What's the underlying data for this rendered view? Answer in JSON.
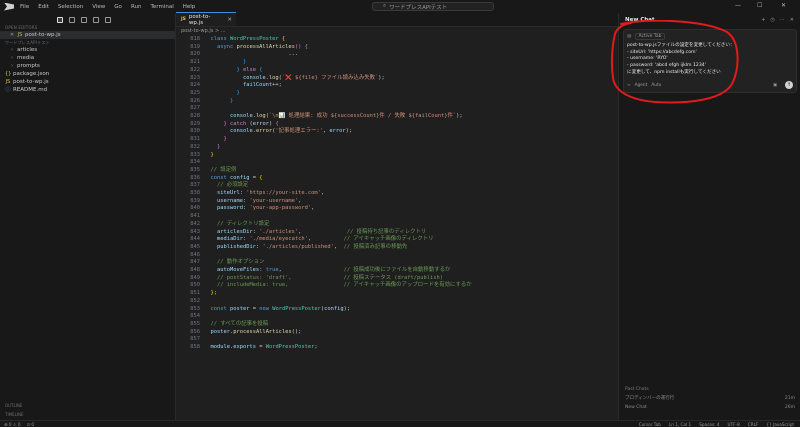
{
  "menu": [
    "File",
    "Edit",
    "Selection",
    "View",
    "Go",
    "Run",
    "Terminal",
    "Help"
  ],
  "search": {
    "placeholder": "ワードプレスAPIテスト"
  },
  "explorer": {
    "open_editors_label": "OPEN EDITORS",
    "open_file": "post-to-wp.js",
    "workspace_label": "ワードプレスAPIテスト",
    "items": [
      {
        "label": "articles",
        "kind": "folder"
      },
      {
        "label": "media",
        "kind": "folder"
      },
      {
        "label": "prompts",
        "kind": "folder"
      },
      {
        "label": "package.json",
        "kind": "json"
      },
      {
        "label": "post-to-wp.js",
        "kind": "js"
      },
      {
        "label": "README.md",
        "kind": "md"
      }
    ],
    "outline_label": "OUTLINE",
    "timeline_label": "TIMELINE"
  },
  "editor": {
    "tab_label": "post-to-wp.js",
    "breadcrumb": "post-to-wp.js > ...",
    "lines": [
      {
        "n": "",
        "html": "  <span class='kw'>class</span> <span class='cls'>WordPressPoster</span> <span class='br'>{</span>"
      },
      {
        "n": "",
        "html": "    <span class='kw'>async</span> <span class='fn'>processAllArticles</span><span class='br2'>()</span> <span class='br2'>{</span>"
      },
      {
        "n": "",
        "html": "                          <span class='pl'>...</span>"
      },
      {
        "n": "",
        "html": "            <span class='br3'>}</span>"
      },
      {
        "n": "",
        "html": "          <span class='br3'>}</span> <span class='kw2'>else</span> <span class='br3'>{</span>"
      },
      {
        "n": "",
        "html": "            <span class='var'>console</span>.<span class='fn'>log</span>(<span class='str'>`❌ ${file} ファイル読み込み失敗`</span>);"
      },
      {
        "n": "",
        "html": "            <span class='var'>failCount</span>++;"
      },
      {
        "n": "",
        "html": "          <span class='br3'>}</span>"
      },
      {
        "n": "",
        "html": "        <span class='br3'>}</span>"
      },
      {
        "n": "",
        "html": ""
      },
      {
        "n": "",
        "html": "        <span class='var'>console</span>.<span class='fn'>log</span>(<span class='str'>`\\n📊 処理結果: 成功 ${successCount}件 / 失敗 ${failCount}件`</span>);"
      },
      {
        "n": "",
        "html": "      <span class='br2'>}</span> <span class='kw2'>catch</span> (<span class='var'>error</span>) <span class='br2'>{</span>"
      },
      {
        "n": "",
        "html": "        <span class='var'>console</span>.<span class='fn'>error</span>(<span class='str'>'記事処理エラー:'</span>, <span class='var'>error</span>);"
      },
      {
        "n": "",
        "html": "      <span class='br2'>}</span>"
      },
      {
        "n": "",
        "html": "    <span class='br2'>}</span>"
      },
      {
        "n": "",
        "html": "  <span class='br'>}</span>"
      },
      {
        "n": "",
        "html": ""
      },
      {
        "n": "",
        "html": "  <span class='cm'>// 設定例</span>"
      },
      {
        "n": "",
        "html": "  <span class='kw'>const</span> <span class='var'>config</span> = <span class='br'>{</span>"
      },
      {
        "n": "",
        "html": "    <span class='cm'>// 必須設定</span>"
      },
      {
        "n": "",
        "html": "    <span class='var'>siteUrl</span>: <span class='str'>'https://your-site.com'</span>,"
      },
      {
        "n": "",
        "html": "    <span class='var'>username</span>: <span class='str'>'your-username'</span>,"
      },
      {
        "n": "",
        "html": "    <span class='var'>password</span>: <span class='str'>'your-app-password'</span>,"
      },
      {
        "n": "",
        "html": ""
      },
      {
        "n": "",
        "html": "    <span class='cm'>// ディレクトリ設定</span>"
      },
      {
        "n": "",
        "html": "    <span class='var'>articlesDir</span>: <span class='str'>'./articles'</span>,              <span class='cm'>// 投稿待ち記事のディレクトリ</span>"
      },
      {
        "n": "",
        "html": "    <span class='var'>mediaDir</span>: <span class='str'>'./media/eyecatch'</span>,          <span class='cm'>// アイキャッチ画像のディレクトリ</span>"
      },
      {
        "n": "",
        "html": "    <span class='var'>publishedDir</span>: <span class='str'>'./articles/published'</span>,  <span class='cm'>// 投稿済み記事の移動先</span>"
      },
      {
        "n": "",
        "html": ""
      },
      {
        "n": "",
        "html": "    <span class='cm'>// 動作オプション</span>"
      },
      {
        "n": "",
        "html": "    <span class='var'>autoMoveFiles</span>: <span class='kw'>true</span>,                   <span class='cm'>// 投稿成功後にファイルを自動移動するか</span>"
      },
      {
        "n": "",
        "html": "    <span class='cm'>// postStatus: 'draft',                // 投稿ステータス (draft/publish)</span>"
      },
      {
        "n": "",
        "html": "    <span class='cm'>// includeMedia: true,                 // アイキャッチ画像のアップロードを有効にするか</span>"
      },
      {
        "n": "",
        "html": "  <span class='br'>}</span>;"
      },
      {
        "n": "",
        "html": ""
      },
      {
        "n": "",
        "html": "  <span class='kw'>const</span> <span class='var'>poster</span> = <span class='kw'>new</span> <span class='cls'>WordPressPoster</span>(<span class='var'>config</span>);"
      },
      {
        "n": "",
        "html": ""
      },
      {
        "n": "",
        "html": "  <span class='cm'>// すべての記事を投稿</span>"
      },
      {
        "n": "",
        "html": "  <span class='var'>poster</span>.<span class='fn'>processAllArticles</span>();"
      },
      {
        "n": "",
        "html": ""
      },
      {
        "n": "",
        "html": "  <span class='var'>module</span>.<span class='var'>exports</span> = <span class='cls'>WordPressPoster</span>;"
      }
    ]
  },
  "chat": {
    "title": "New Chat",
    "context_label": "Active Tab",
    "message_lines": [
      "post-to-wp.jsファイルの設定を変更してください：",
      "- siteUrl: 'https://abcdefg.com'",
      "- username: 'RYO'",
      "- password: 'abcd efgh ijklm 1234'",
      "に変更して、npm installも実行してください"
    ],
    "mode_label": "Agent",
    "model_label": "Auto",
    "past_chats_label": "Past Chats",
    "past_chats": [
      {
        "title": "プロディンバーの運行行",
        "time": "21m"
      },
      {
        "title": "New Chat",
        "time": "26m"
      }
    ]
  },
  "status": {
    "left": [
      "⊗ 0 ⚠ 0",
      "⊙ 0"
    ],
    "right": [
      "Cursor Tab",
      "Ln 1, Col 1",
      "Spaces: 4",
      "UTF-8",
      "CRLF",
      "{} JavaScript"
    ]
  },
  "annotation_color": "#e01b1b"
}
